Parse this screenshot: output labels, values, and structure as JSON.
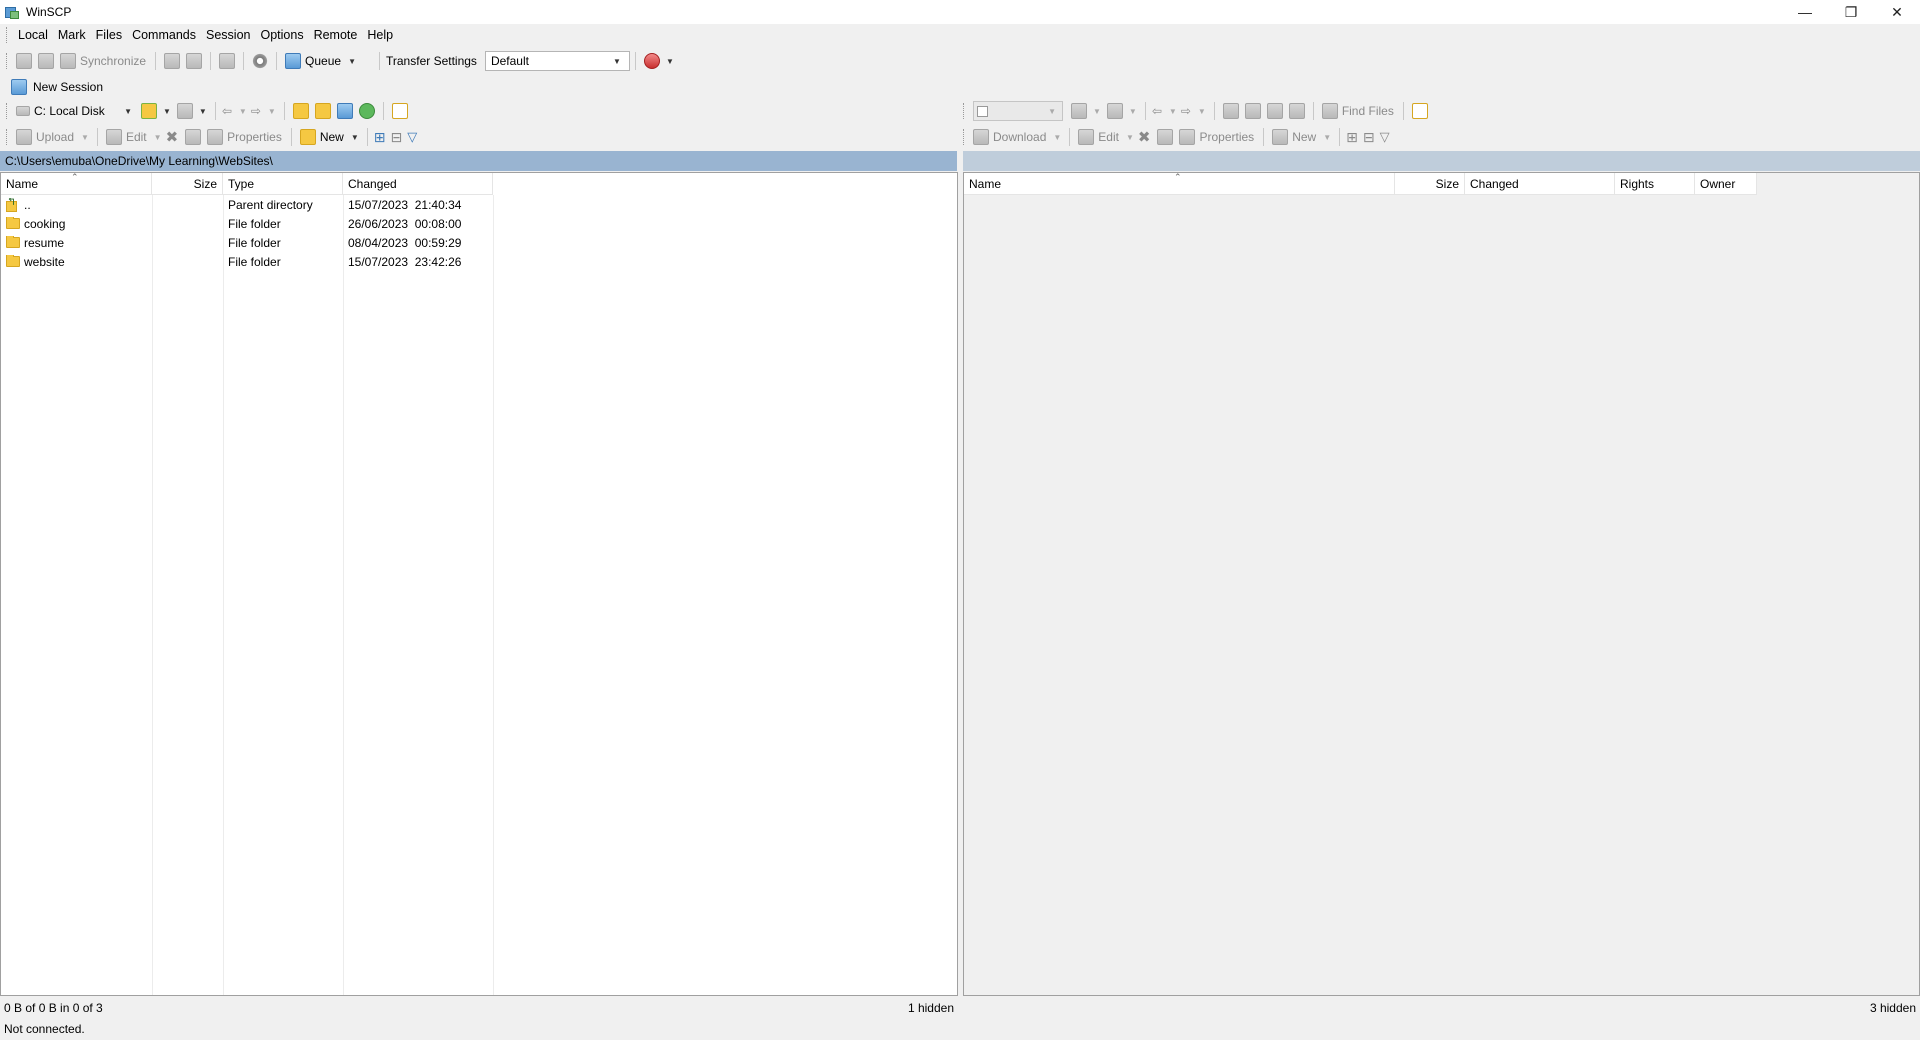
{
  "window": {
    "title": "WinSCP"
  },
  "menu": [
    "Local",
    "Mark",
    "Files",
    "Commands",
    "Session",
    "Options",
    "Remote",
    "Help"
  ],
  "toolbar": {
    "synchronize": "Synchronize",
    "queue": "Queue",
    "transfer_settings_label": "Transfer Settings",
    "transfer_settings_value": "Default"
  },
  "tabs": {
    "new_session": "New Session"
  },
  "local": {
    "drive": "C: Local Disk",
    "upload": "Upload",
    "edit": "Edit",
    "properties": "Properties",
    "new": "New",
    "path": "C:\\Users\\emuba\\OneDrive\\My Learning\\WebSites\\",
    "columns": [
      "Name",
      "Size",
      "Type",
      "Changed"
    ],
    "rows": [
      {
        "name": "..",
        "size": "",
        "type": "Parent directory",
        "changed": "15/07/2023  21:40:34"
      },
      {
        "name": "cooking",
        "size": "",
        "type": "File folder",
        "changed": "26/06/2023  00:08:00"
      },
      {
        "name": "resume",
        "size": "",
        "type": "File folder",
        "changed": "08/04/2023  00:59:29"
      },
      {
        "name": "website",
        "size": "",
        "type": "File folder",
        "changed": "15/07/2023  23:42:26"
      }
    ],
    "status_left": "0 B of 0 B in 0 of 3",
    "status_right": "1 hidden"
  },
  "remote": {
    "find_files": "Find Files",
    "download": "Download",
    "edit": "Edit",
    "properties": "Properties",
    "new": "New",
    "columns": [
      "Name",
      "Size",
      "Changed",
      "Rights",
      "Owner"
    ],
    "status_right": "3 hidden"
  },
  "connection_status": "Not connected."
}
